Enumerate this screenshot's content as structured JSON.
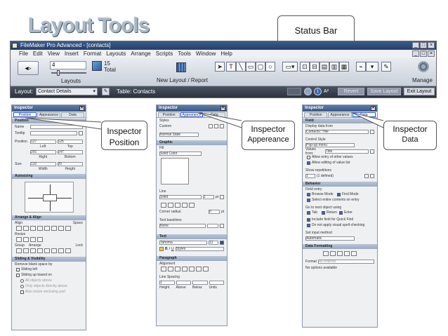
{
  "slide": {
    "title": "Layout Tools"
  },
  "callouts": {
    "status_bar": "Status Bar",
    "inspector_position_l1": "Inspector",
    "inspector_position_l2": "Position",
    "inspector_appearance_l1": "Inspector",
    "inspector_appearance_l2": "Appereance",
    "inspector_data_l1": "Inspector",
    "inspector_data_l2": "Data"
  },
  "window": {
    "title": "FileMaker Pro Advanced - [contacts]",
    "menu": [
      "File",
      "Edit",
      "View",
      "Insert",
      "Format",
      "Layouts",
      "Arrange",
      "Scripts",
      "Tools",
      "Window",
      "Help"
    ],
    "toolbar": {
      "layout_number": "4",
      "total_count": "15",
      "total_label": "Total",
      "layouts_label": "Layouts",
      "new_layout_label": "New Layout / Report",
      "manage_label": "Manage"
    },
    "status": {
      "layout_label": "Layout:",
      "layout_value": "Contact Details",
      "table_label": "Table: Contacts",
      "revert_label": "Revert",
      "save_label": "Save Layout",
      "exit_label": "Exit Layout"
    }
  },
  "inspectors": {
    "title": "Inspector",
    "tabs": [
      "Position",
      "Appearance",
      "Data"
    ],
    "position": {
      "sec_position": "Position",
      "name_label": "Name",
      "tooltip_label": "Tooltip",
      "position_label": "Position",
      "pos_left": "127",
      "pos_top": "125",
      "left_label": "Left",
      "top_label": "Top",
      "pos_right": "291",
      "pos_bottom": "147",
      "right_label": "Right",
      "bottom_label": "Bottom",
      "size_label": "Size",
      "size_w": "132",
      "size_h": "20",
      "width_label": "Width",
      "height_label": "Height",
      "sec_autosizing": "Autosizing",
      "sec_arrange": "Arrange & Align",
      "align_label": "Align",
      "space_label": "Space",
      "resize_label": "Resize",
      "group_label": "Group",
      "arrange_label": "Arrange",
      "lock_label": "Lock",
      "sec_sliding": "Sliding & Visibility",
      "remove_blank": "Remove blank space by",
      "sliding_left": "Sliding left",
      "sliding_up": "Sliding up based on",
      "all_above": "All objects above",
      "only_directly": "Only objects directly above",
      "also_resize": "Also resize enclosing part"
    },
    "appearance": {
      "styles_label": "Styles",
      "custom_label": "Custom",
      "state_value": "Normal State",
      "sec_graphic": "Graphic",
      "fill_label": "Fill",
      "fill_value": "Solid Color",
      "line_label": "Line",
      "line_value": "Solid",
      "line_width": "1",
      "pt_label": "pt",
      "corner_label": "Corner radius:",
      "corner_value": "0",
      "text_baselines": "Text baselines",
      "none_value": "None",
      "sec_text": "Text",
      "font_value": "Tahoma",
      "size_value": "12",
      "styles_value": "Styles",
      "sec_paragraph": "Paragraph",
      "alignment_label": "Alignment",
      "spacing_label": "Line Spacing",
      "spacing_height": "1",
      "height_label": "Height",
      "above_label": "Above",
      "below_label": "Below",
      "units_label": "Units"
    },
    "data": {
      "sec_field": "Field",
      "display_label": "Display data from",
      "display_value": "Contacts::Title",
      "control_label": "Control Style",
      "control_value": "Pop-up menu",
      "values_label": "Values from:",
      "values_value": "Title",
      "include_arbitrary": "Allow entry of other values",
      "allow_editing": "Allow editing of value list",
      "show_reps": "Show repetitions",
      "reps_value": "1",
      "defined_label": "(1 defined)",
      "sec_behavior": "Behavior",
      "field_entry": "Field entry",
      "browse_mode": "Browse Mode",
      "find_mode": "Find Mode",
      "select_contents": "Select entire contents on entry",
      "go_next": "Go to next object using",
      "tab_key": "Tab",
      "return_key": "Return",
      "enter_key": "Enter",
      "include_quick_find": "Include field for Quick Find",
      "no_spell": "Do not apply visual spell-checking",
      "input_method": "Set input method",
      "input_value": "Automatic",
      "sec_formatting": "Data Formatting",
      "format_label": "Format",
      "format_value": "As entered",
      "no_options": "No options available"
    }
  },
  "colors": {
    "title_fill": "#a9b6c4",
    "inspector_header": "#3c5a86",
    "highlight": "#2255dd"
  }
}
